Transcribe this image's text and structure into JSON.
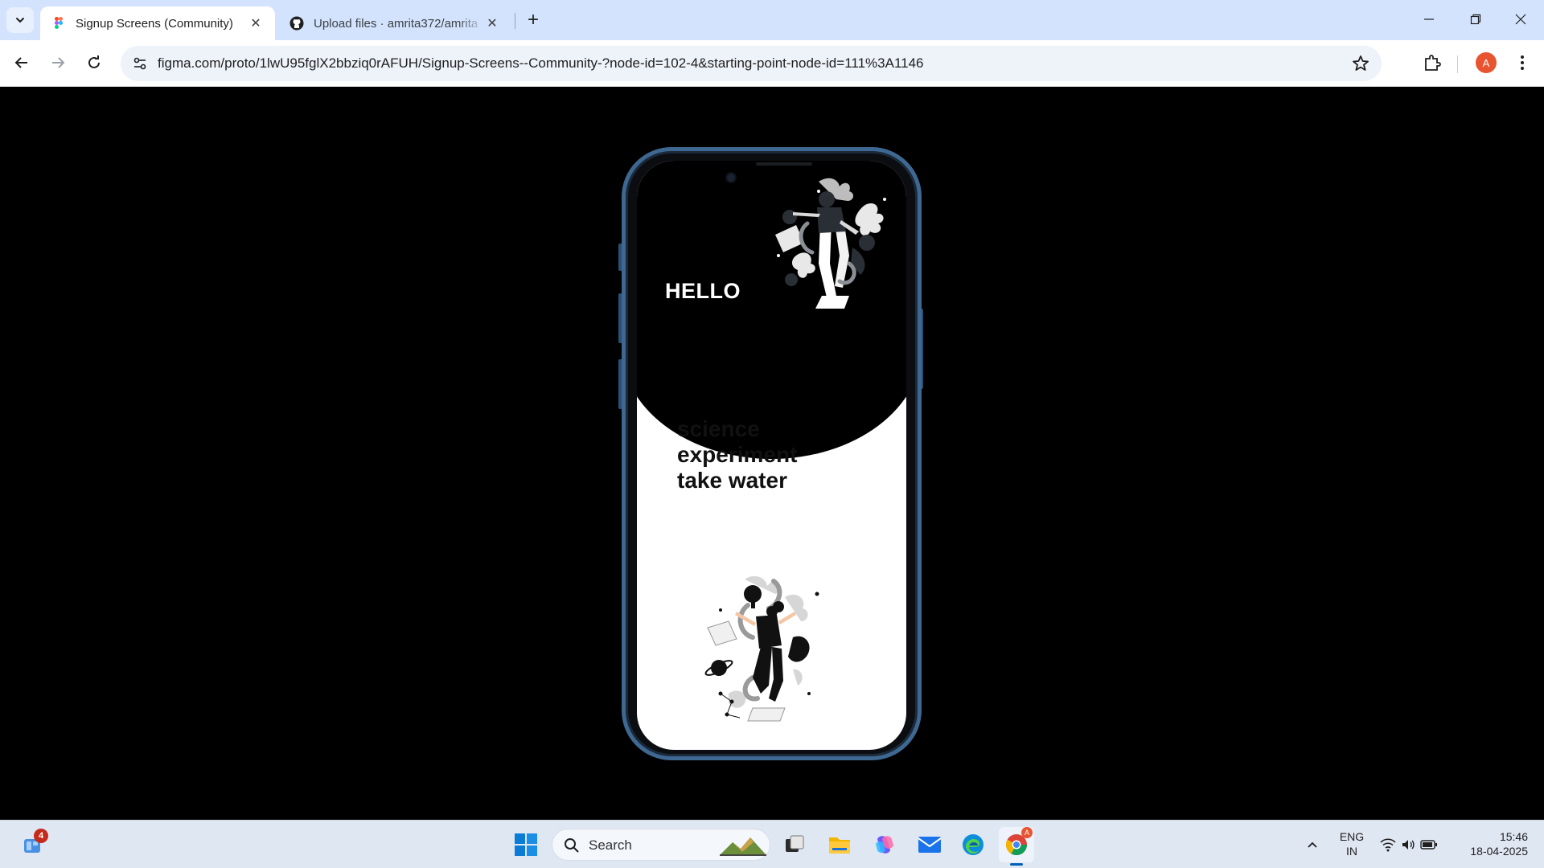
{
  "browser": {
    "tabs": [
      {
        "title": "Signup Screens (Community)",
        "active": true,
        "icon": "figma-icon"
      },
      {
        "title": "Upload files · amrita372/amrita",
        "active": false,
        "icon": "github-icon"
      }
    ],
    "url": "figma.com/proto/1lwU95fglX2bbziq0rAFUH/Signup-Screens--Community-?node-id=102-4&starting-point-node-id=111%3A1146",
    "profile_initial": "A",
    "accent_color": "#e8542f"
  },
  "prototype": {
    "hello": "HELLO",
    "headline_lines": [
      "science",
      "experiment",
      "take water"
    ],
    "frame_color": "#3e6891"
  },
  "taskbar": {
    "widgets_badge": "4",
    "search_label": "Search",
    "lang_primary": "ENG",
    "lang_secondary": "IN",
    "time": "15:46",
    "date": "18-04-2025"
  }
}
